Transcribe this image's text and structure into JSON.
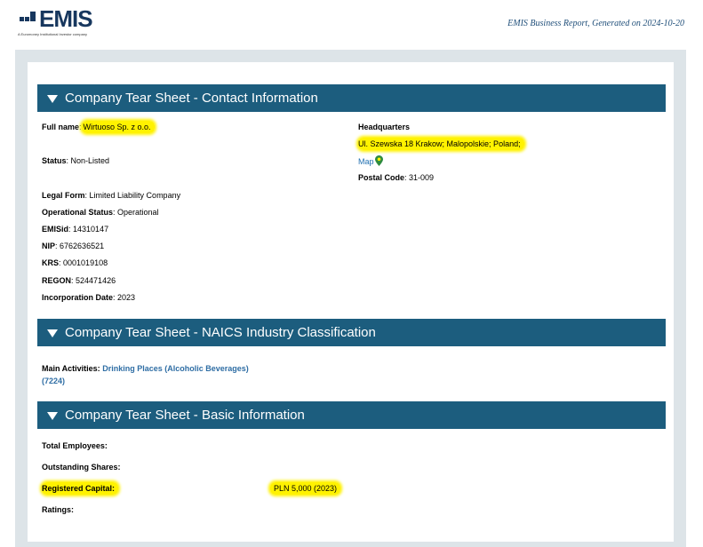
{
  "header": {
    "logo_text": "EMIS",
    "logo_tagline": "A Euromoney Institutional Investor company",
    "report_title": "EMIS Business Report, Generated on 2024-10-20"
  },
  "sections": {
    "contact": "Company Tear Sheet - Contact Information",
    "naics": "Company Tear Sheet - NAICS Industry Classification",
    "basic": "Company Tear Sheet - Basic Information"
  },
  "contact": {
    "full_name_label": "Full name",
    "full_name_value": "Wirtuoso Sp. z o.o.",
    "status_label": "Status",
    "status_value": "Non-Listed",
    "legal_form_label": "Legal Form",
    "legal_form_value": "Limited Liability Company",
    "op_status_label": "Operational Status",
    "op_status_value": "Operational",
    "emisid_label": "EMISid",
    "emisid_value": "14310147",
    "nip_label": "NIP",
    "nip_value": "6762636521",
    "krs_label": "KRS",
    "krs_value": "0001019108",
    "regon_label": "REGON",
    "regon_value": "524471426",
    "inc_date_label": "Incorporation Date",
    "inc_date_value": "2023",
    "hq_label": "Headquarters",
    "hq_address": "Ul. Szewska 18 Krakow; Malopolskie; Poland;",
    "map_link": "Map",
    "postal_label": "Postal Code",
    "postal_value": "31-009"
  },
  "naics": {
    "main_activities_label": "Main Activities:",
    "main_activities_value": "Drinking Places (Alcoholic Beverages)",
    "main_activities_code": "(7224)"
  },
  "basic": {
    "employees_label": "Total Employees:",
    "shares_label": "Outstanding Shares:",
    "capital_label": "Registered Capital:",
    "capital_value": "PLN 5,000 (2023)",
    "ratings_label": "Ratings:"
  },
  "colors": {
    "section_bar": "#1c5d7e",
    "highlight": "#fff200",
    "link": "#1f6fb0",
    "brand": "#17375e"
  }
}
